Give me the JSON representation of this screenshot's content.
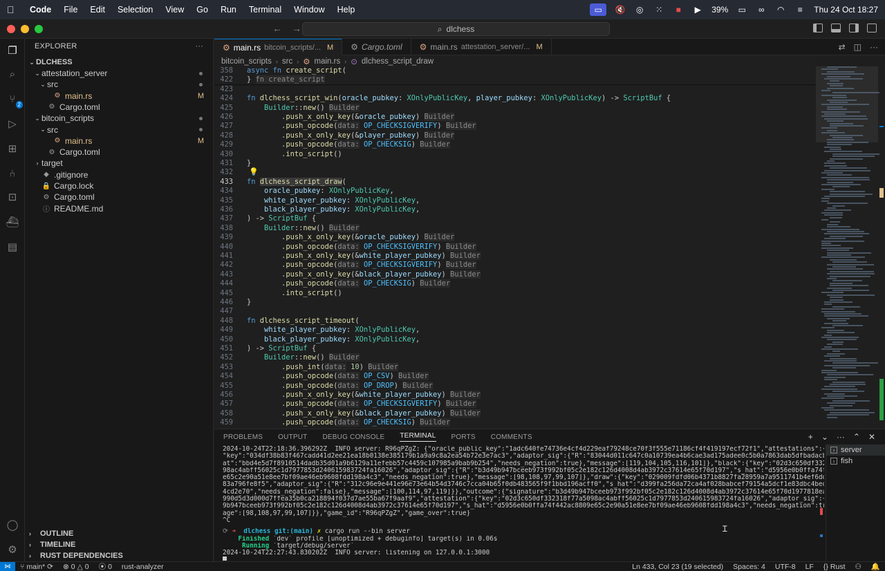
{
  "menubar": {
    "app": "Code",
    "items": [
      "File",
      "Edit",
      "Selection",
      "View",
      "Go",
      "Run",
      "Terminal",
      "Window",
      "Help"
    ],
    "battery": "39%",
    "datetime": "Thu 24 Oct  18:27"
  },
  "titlebar": {
    "search": "dlchess"
  },
  "activity": {
    "scm_badge": "2"
  },
  "sidebar": {
    "title": "EXPLORER",
    "root": "DLCHESS",
    "tree": [
      {
        "label": "attestation_server",
        "depth": 1,
        "kind": "folder-open",
        "status": "dot"
      },
      {
        "label": "src",
        "depth": 2,
        "kind": "folder-open",
        "status": "dot"
      },
      {
        "label": "main.rs",
        "depth": 3,
        "kind": "rust",
        "status": "M"
      },
      {
        "label": "Cargo.toml",
        "depth": 2,
        "kind": "toml",
        "status": ""
      },
      {
        "label": "bitcoin_scripts",
        "depth": 1,
        "kind": "folder-open",
        "status": "dot"
      },
      {
        "label": "src",
        "depth": 2,
        "kind": "folder-open",
        "status": "dot"
      },
      {
        "label": "main.rs",
        "depth": 3,
        "kind": "rust",
        "status": "M"
      },
      {
        "label": "Cargo.toml",
        "depth": 2,
        "kind": "toml",
        "status": ""
      },
      {
        "label": "target",
        "depth": 1,
        "kind": "folder-closed",
        "status": ""
      },
      {
        "label": ".gitignore",
        "depth": 1,
        "kind": "git",
        "status": ""
      },
      {
        "label": "Cargo.lock",
        "depth": 1,
        "kind": "lock",
        "status": ""
      },
      {
        "label": "Cargo.toml",
        "depth": 1,
        "kind": "toml",
        "status": ""
      },
      {
        "label": "README.md",
        "depth": 1,
        "kind": "md",
        "status": ""
      }
    ],
    "sections": [
      "OUTLINE",
      "TIMELINE",
      "RUST DEPENDENCIES"
    ]
  },
  "tabs": [
    {
      "label": "main.rs",
      "sub": "bitcoin_scripts/...",
      "mod": "M",
      "active": true,
      "italic": false
    },
    {
      "label": "Cargo.toml",
      "sub": "",
      "mod": "",
      "active": false,
      "italic": true
    },
    {
      "label": "main.rs",
      "sub": "attestation_server/...",
      "mod": "M",
      "active": false,
      "italic": false
    }
  ],
  "breadcrumb": [
    "bitcoin_scripts",
    "src",
    "main.rs",
    "dlchess_script_draw"
  ],
  "code": [
    {
      "ln": "358",
      "tokens": [
        [
          "kw",
          "async "
        ],
        [
          "kw",
          "fn "
        ],
        [
          "fn",
          "create_script"
        ],
        [
          "",
          "("
        ]
      ]
    },
    {
      "ln": "422",
      "tokens": [
        [
          "",
          "} "
        ],
        [
          "hint",
          "fn create_script"
        ]
      ]
    },
    {
      "ln": "423",
      "tokens": []
    },
    {
      "ln": "424",
      "tokens": [
        [
          "kw",
          "fn "
        ],
        [
          "fn",
          "dlchess_script_win"
        ],
        [
          "",
          "("
        ],
        [
          "var",
          "oracle_pubkey"
        ],
        [
          "",
          ": "
        ],
        [
          "ty",
          "XOnlyPublicKey"
        ],
        [
          "",
          ", "
        ],
        [
          "var",
          "player_pubkey"
        ],
        [
          "",
          ": "
        ],
        [
          "ty",
          "XOnlyPublicKey"
        ],
        [
          "",
          ") -> "
        ],
        [
          "ty",
          "ScriptBuf"
        ],
        [
          "",
          " {"
        ]
      ]
    },
    {
      "ln": "425",
      "tokens": [
        [
          "",
          "    "
        ],
        [
          "ty",
          "Builder"
        ],
        [
          "",
          "::"
        ],
        [
          "fn",
          "new"
        ],
        [
          "",
          "() "
        ],
        [
          "hint",
          "Builder"
        ]
      ]
    },
    {
      "ln": "426",
      "tokens": [
        [
          "",
          "        ."
        ],
        [
          "fn",
          "push_x_only_key"
        ],
        [
          "",
          "(&"
        ],
        [
          "var",
          "oracle_pubkey"
        ],
        [
          "",
          ") "
        ],
        [
          "hint",
          "Builder"
        ]
      ]
    },
    {
      "ln": "427",
      "tokens": [
        [
          "",
          "        ."
        ],
        [
          "fn",
          "push_opcode"
        ],
        [
          "",
          "("
        ],
        [
          "hint",
          "data:"
        ],
        [
          "",
          " "
        ],
        [
          "cst",
          "OP_CHECKSIGVERIFY"
        ],
        [
          "",
          ") "
        ],
        [
          "hint",
          "Builder"
        ]
      ]
    },
    {
      "ln": "428",
      "tokens": [
        [
          "",
          "        ."
        ],
        [
          "fn",
          "push_x_only_key"
        ],
        [
          "",
          "(&"
        ],
        [
          "var",
          "player_pubkey"
        ],
        [
          "",
          ") "
        ],
        [
          "hint",
          "Builder"
        ]
      ]
    },
    {
      "ln": "429",
      "tokens": [
        [
          "",
          "        ."
        ],
        [
          "fn",
          "push_opcode"
        ],
        [
          "",
          "("
        ],
        [
          "hint",
          "data:"
        ],
        [
          "",
          " "
        ],
        [
          "cst",
          "OP_CHECKSIG"
        ],
        [
          "",
          ") "
        ],
        [
          "hint",
          "Builder"
        ]
      ]
    },
    {
      "ln": "430",
      "tokens": [
        [
          "",
          "        ."
        ],
        [
          "fn",
          "into_script"
        ],
        [
          "",
          "()"
        ]
      ]
    },
    {
      "ln": "431",
      "tokens": [
        [
          "",
          "}"
        ]
      ]
    },
    {
      "ln": "432",
      "tokens": []
    },
    {
      "ln": "433",
      "tokens": [
        [
          "kw",
          "fn "
        ],
        [
          "fn hl",
          "dlchess_script_draw"
        ],
        [
          "",
          "("
        ]
      ],
      "current": true
    },
    {
      "ln": "434",
      "tokens": [
        [
          "",
          "    "
        ],
        [
          "var",
          "oracle_pubkey"
        ],
        [
          "",
          ": "
        ],
        [
          "ty",
          "XOnlyPublicKey"
        ],
        [
          "",
          ","
        ]
      ]
    },
    {
      "ln": "435",
      "tokens": [
        [
          "",
          "    "
        ],
        [
          "var",
          "white_player_pubkey"
        ],
        [
          "",
          ": "
        ],
        [
          "ty",
          "XOnlyPublicKey"
        ],
        [
          "",
          ","
        ]
      ]
    },
    {
      "ln": "436",
      "tokens": [
        [
          "",
          "    "
        ],
        [
          "var",
          "black_player_pubkey"
        ],
        [
          "",
          ": "
        ],
        [
          "ty",
          "XOnlyPublicKey"
        ],
        [
          "",
          ","
        ]
      ]
    },
    {
      "ln": "437",
      "tokens": [
        [
          "",
          ") -> "
        ],
        [
          "ty",
          "ScriptBuf"
        ],
        [
          "",
          " {"
        ]
      ]
    },
    {
      "ln": "438",
      "tokens": [
        [
          "",
          "    "
        ],
        [
          "ty",
          "Builder"
        ],
        [
          "",
          "::"
        ],
        [
          "fn",
          "new"
        ],
        [
          "",
          "() "
        ],
        [
          "hint",
          "Builder"
        ]
      ]
    },
    {
      "ln": "439",
      "tokens": [
        [
          "",
          "        ."
        ],
        [
          "fn",
          "push_x_only_key"
        ],
        [
          "",
          "(&"
        ],
        [
          "var",
          "oracle_pubkey"
        ],
        [
          "",
          ") "
        ],
        [
          "hint",
          "Builder"
        ]
      ]
    },
    {
      "ln": "440",
      "tokens": [
        [
          "",
          "        ."
        ],
        [
          "fn",
          "push_opcode"
        ],
        [
          "",
          "("
        ],
        [
          "hint",
          "data:"
        ],
        [
          "",
          " "
        ],
        [
          "cst",
          "OP_CHECKSIGVERIFY"
        ],
        [
          "",
          ") "
        ],
        [
          "hint",
          "Builder"
        ]
      ]
    },
    {
      "ln": "441",
      "tokens": [
        [
          "",
          "        ."
        ],
        [
          "fn",
          "push_x_only_key"
        ],
        [
          "",
          "(&"
        ],
        [
          "var",
          "white_player_pubkey"
        ],
        [
          "",
          ") "
        ],
        [
          "hint",
          "Builder"
        ]
      ]
    },
    {
      "ln": "442",
      "tokens": [
        [
          "",
          "        ."
        ],
        [
          "fn",
          "push_opcode"
        ],
        [
          "",
          "("
        ],
        [
          "hint",
          "data:"
        ],
        [
          "",
          " "
        ],
        [
          "cst",
          "OP_CHECKSIGVERIFY"
        ],
        [
          "",
          ") "
        ],
        [
          "hint",
          "Builder"
        ]
      ]
    },
    {
      "ln": "443",
      "tokens": [
        [
          "",
          "        ."
        ],
        [
          "fn",
          "push_x_only_key"
        ],
        [
          "",
          "(&"
        ],
        [
          "var",
          "black_player_pubkey"
        ],
        [
          "",
          ") "
        ],
        [
          "hint",
          "Builder"
        ]
      ]
    },
    {
      "ln": "444",
      "tokens": [
        [
          "",
          "        ."
        ],
        [
          "fn",
          "push_opcode"
        ],
        [
          "",
          "("
        ],
        [
          "hint",
          "data:"
        ],
        [
          "",
          " "
        ],
        [
          "cst",
          "OP_CHECKSIG"
        ],
        [
          "",
          ") "
        ],
        [
          "hint",
          "Builder"
        ]
      ]
    },
    {
      "ln": "445",
      "tokens": [
        [
          "",
          "        ."
        ],
        [
          "fn",
          "into_script"
        ],
        [
          "",
          "()"
        ]
      ]
    },
    {
      "ln": "446",
      "tokens": [
        [
          "",
          "}"
        ]
      ]
    },
    {
      "ln": "447",
      "tokens": []
    },
    {
      "ln": "448",
      "tokens": [
        [
          "kw",
          "fn "
        ],
        [
          "fn",
          "dlchess_script_timeout"
        ],
        [
          "",
          "("
        ]
      ]
    },
    {
      "ln": "449",
      "tokens": [
        [
          "",
          "    "
        ],
        [
          "var",
          "white_player_pubkey"
        ],
        [
          "",
          ": "
        ],
        [
          "ty",
          "XOnlyPublicKey"
        ],
        [
          "",
          ","
        ]
      ]
    },
    {
      "ln": "450",
      "tokens": [
        [
          "",
          "    "
        ],
        [
          "var",
          "black_player_pubkey"
        ],
        [
          "",
          ": "
        ],
        [
          "ty",
          "XOnlyPublicKey"
        ],
        [
          "",
          ","
        ]
      ]
    },
    {
      "ln": "451",
      "tokens": [
        [
          "",
          ") -> "
        ],
        [
          "ty",
          "ScriptBuf"
        ],
        [
          "",
          " {"
        ]
      ]
    },
    {
      "ln": "452",
      "tokens": [
        [
          "",
          "    "
        ],
        [
          "ty",
          "Builder"
        ],
        [
          "",
          "::"
        ],
        [
          "fn",
          "new"
        ],
        [
          "",
          "() "
        ],
        [
          "hint",
          "Builder"
        ]
      ]
    },
    {
      "ln": "453",
      "tokens": [
        [
          "",
          "        ."
        ],
        [
          "fn",
          "push_int"
        ],
        [
          "",
          "("
        ],
        [
          "hint",
          "data:"
        ],
        [
          "",
          " "
        ],
        [
          "num",
          "10"
        ],
        [
          "",
          ") "
        ],
        [
          "hint",
          "Builder"
        ]
      ]
    },
    {
      "ln": "454",
      "tokens": [
        [
          "",
          "        ."
        ],
        [
          "fn",
          "push_opcode"
        ],
        [
          "",
          "("
        ],
        [
          "hint",
          "data:"
        ],
        [
          "",
          " "
        ],
        [
          "cst",
          "OP_CSV"
        ],
        [
          "",
          ") "
        ],
        [
          "hint",
          "Builder"
        ]
      ]
    },
    {
      "ln": "455",
      "tokens": [
        [
          "",
          "        ."
        ],
        [
          "fn",
          "push_opcode"
        ],
        [
          "",
          "("
        ],
        [
          "hint",
          "data:"
        ],
        [
          "",
          " "
        ],
        [
          "cst",
          "OP_DROP"
        ],
        [
          "",
          ") "
        ],
        [
          "hint",
          "Builder"
        ]
      ]
    },
    {
      "ln": "456",
      "tokens": [
        [
          "",
          "        ."
        ],
        [
          "fn",
          "push_x_only_key"
        ],
        [
          "",
          "(&"
        ],
        [
          "var",
          "white_player_pubkey"
        ],
        [
          "",
          ") "
        ],
        [
          "hint",
          "Builder"
        ]
      ]
    },
    {
      "ln": "457",
      "tokens": [
        [
          "",
          "        ."
        ],
        [
          "fn",
          "push_opcode"
        ],
        [
          "",
          "("
        ],
        [
          "hint",
          "data:"
        ],
        [
          "",
          " "
        ],
        [
          "cst",
          "OP_CHECKSIGVERIFY"
        ],
        [
          "",
          ") "
        ],
        [
          "hint",
          "Builder"
        ]
      ]
    },
    {
      "ln": "458",
      "tokens": [
        [
          "",
          "        ."
        ],
        [
          "fn",
          "push_x_only_key"
        ],
        [
          "",
          "(&"
        ],
        [
          "var",
          "black_player_pubkey"
        ],
        [
          "",
          ") "
        ],
        [
          "hint",
          "Builder"
        ]
      ]
    },
    {
      "ln": "459",
      "tokens": [
        [
          "",
          "        ."
        ],
        [
          "fn",
          "push_opcode"
        ],
        [
          "",
          "("
        ],
        [
          "hint",
          "data:"
        ],
        [
          "",
          " "
        ],
        [
          "cst",
          "OP_CHECKSIG"
        ],
        [
          "",
          ") "
        ],
        [
          "hint",
          "Builder"
        ]
      ]
    }
  ],
  "panel": {
    "tabs": [
      "PROBLEMS",
      "OUTPUT",
      "DEBUG CONSOLE",
      "TERMINAL",
      "PORTS",
      "COMMENTS"
    ],
    "active_tab": "TERMINAL",
    "terminals": [
      "server",
      "fish"
    ]
  },
  "terminal": {
    "log": [
      "2024-10-24T22:18:36.396292Z  INFO server: R96qPZgZ: {\"oracle_public_key\":\"1adc640fe74736e4cf4d229eaf79248ce70f3f555e71186cf4f419197ecf72f1\",\"attestations\":{\"white\":{",
      "\"key\":\"034df38b83f467cadd41d2ee21ea18b0138e385179b1a9a9c8a2ea54b72e3e7ac3\",\"adaptor_sig\":{\"R\":\"83044d011c647c0a10739ea4b6cae3ad175adee0c5b0a7863dab5dfbadacbbfd\",\"s_h",
      "at\":\"bbd4e5d7f8910514dadb35d01a9b6129a11efebb57c4459c107985a9bab9b254\",\"needs_negation\":true},\"message\":[119,104,105,116,101]},\"black\":{\"key\":\"02d3c650df332318f77a50",
      "98ac4abff56025c1d7977853d240615983724fa16026\",\"adaptor_sig\":{\"R\":\"b3d49b947bceeb973f992bf05c2e182c126d4008d4ab3972c37614e65f70d197\",\"s_hat\":\"d5956e0b0ffa74f442ac8809",
      "e65c2e90a51e8ee7bf09ae46eb9608fdd198a4c3\",\"needs_negation\":true},\"message\":[98,108,97,99,107]},\"draw\":{\"key\":\"029009fdfd06b4371b8827fa28959a7a9511741b4ef6ddd9877f5cd",
      "83a796fe8f5\",\"adaptor_sig\":{\"R\":\"312c96e9e441e96e73e64b54d3746c7cca04b65f0db483565f9f1bbd196acff0\",\"s_hat\":\"d399fa256da72ca4af028babcef79154a5dcf1e83dbc4bed07e3e7ec7",
      "4cd2e70\",\"needs_negation\":false},\"message\":[100,114,97,119]}},\"outcome\":{\"signature\":\"b3d49b947bceeb973f992bf05c2e182c126d4008d4ab3972c37614e65f70d1977818eaa5414e510",
      "990d5d3d000d7ffea35b0ca218894f037d7ae55ba67f9aaf9\",\"attestation\":{\"key\":\"02d3c650df332318f77a5098ac4abff56025c1d7977853d240615983724fa16026\",\"adaptor_sig\":{\"R\":\"b3d4",
      "9b947bceeb973f992bf05c2e182c126d4008d4ab3972c37614e65f70d197\",\"s_hat\":\"d5956e0b0ffa74f442ac8809e65c2e90a51e8ee7bf09ae46eb9608fdd198a4c3\",\"needs_negation\":true},\"mess",
      "age\":[98,108,97,99,107]}},\"game_id\":\"R96qPZgZ\",\"game_over\":true}",
      "^C"
    ],
    "prompt_dir": "dlchess",
    "prompt_git": "git:(main)",
    "prompt_mark": "✗",
    "command": "cargo run --bin server",
    "finished_word": "Finished",
    "finished_rest": "`dev` profile [unoptimized + debuginfo] target(s) in 0.06s",
    "running_word": "Running",
    "running_rest": "`target/debug/server`",
    "listen": "2024-10-24T22:27:43.830202Z  INFO server: listening on 127.0.0.1:3000"
  },
  "status": {
    "branch": "main*",
    "errors": "0",
    "warnings": "0",
    "ports": "0",
    "analyzer": "rust-analyzer",
    "position": "Ln 433, Col 23 (19 selected)",
    "spaces": "Spaces: 4",
    "encoding": "UTF-8",
    "eol": "LF",
    "language": "Rust"
  },
  "colors": {
    "accent": "#0078d4",
    "modified": "#e2c08d"
  }
}
